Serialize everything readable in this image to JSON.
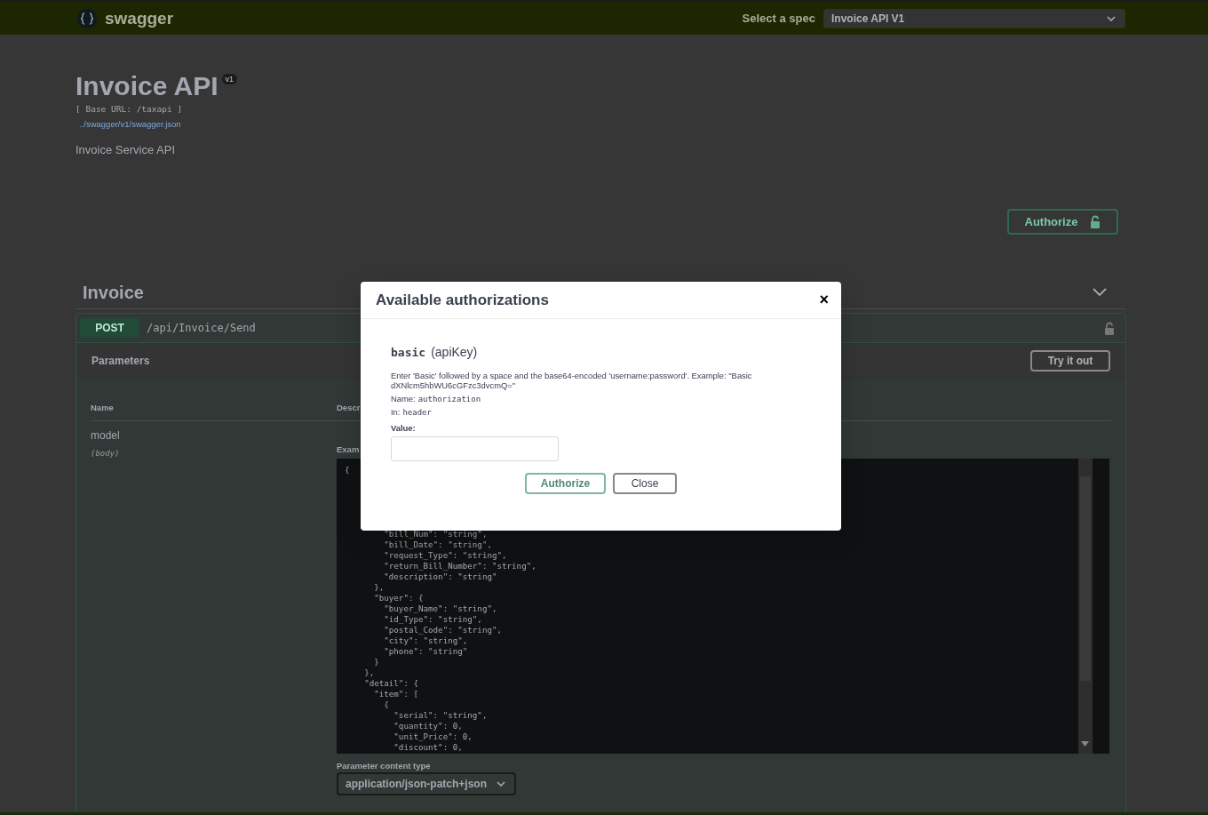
{
  "topbar": {
    "brand": "swagger",
    "spec_label": "Select a spec",
    "spec_value": "Invoice API V1"
  },
  "info": {
    "title": "Invoice API",
    "version": "v1",
    "base_url": "[ Base URL: /taxapi ]",
    "spec_link": "../swagger/v1/swagger.json",
    "description": "Invoice Service API"
  },
  "authorize_button": "Authorize",
  "section": {
    "title": "Invoice",
    "expanded": true,
    "operation": {
      "method": "POST",
      "path": "/api/Invoice/Send",
      "parameters_title": "Parameters",
      "try_button": "Try it out",
      "columns": [
        "Name",
        "Descr"
      ],
      "param": {
        "name": "model",
        "location": "(body)"
      },
      "example_tab": "Exam",
      "code_top": [
        "{"
      ],
      "code_lines": [
        "        \"bill_Num\": \"string\",",
        "        \"bill_Date\": \"string\",",
        "        \"request_Type\": \"string\",",
        "        \"return_Bill_Number\": \"string\",",
        "        \"description\": \"string\"",
        "      },",
        "      \"buyer\": {",
        "        \"buyer_Name\": \"string\",",
        "        \"id_Type\": \"string\",",
        "        \"postal_Code\": \"string\",",
        "        \"city\": \"string\",",
        "        \"phone\": \"string\"",
        "      }",
        "    },",
        "    \"detail\": {",
        "      \"item\": [",
        "        {",
        "          \"serial\": \"string\",",
        "          \"quantity\": 0,",
        "          \"unit_Price\": 0,",
        "          \"discount\": 0,"
      ],
      "content_type_label": "Parameter content type",
      "content_type": "application/json-patch+json"
    }
  },
  "modal": {
    "title": "Available authorizations",
    "close": "×",
    "scheme": "basic",
    "scheme_type": "(apiKey)",
    "description": "Enter 'Basic' followed by a space and the base64-encoded 'username:password'. Example: \"Basic dXNlcm5hbWU6cGFzc3dvcmQ=\"",
    "name_label": "Name:",
    "name_value": "authorization",
    "in_label": "In:",
    "in_value": "header",
    "value_label": "Value:",
    "buttons": [
      {
        "label": "Authorize",
        "kind": "primary"
      },
      {
        "label": "Close",
        "kind": "secondary"
      }
    ]
  }
}
